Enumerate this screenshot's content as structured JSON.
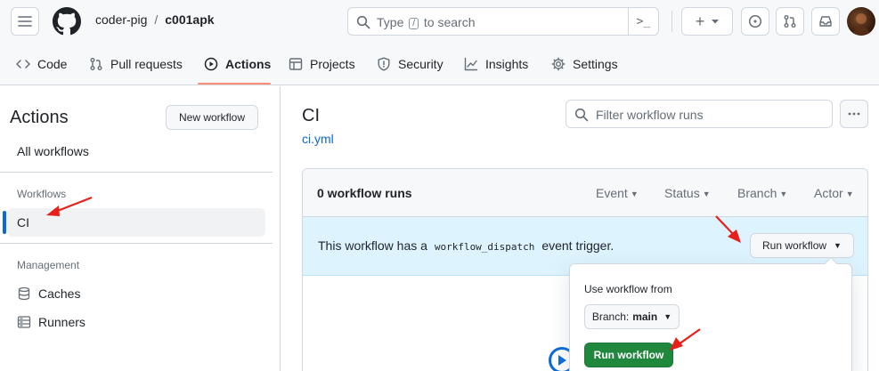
{
  "header": {
    "breadcrumb": {
      "owner": "coder-pig",
      "separator": "/",
      "repo": "c001apk"
    },
    "search": {
      "prefix": "Type",
      "key": "/",
      "suffix": "to search",
      "command_glyph": ">_"
    },
    "create_glyph": "+",
    "icons": [
      "hamburger-icon",
      "github-logo-icon",
      "search-icon",
      "command-palette-icon",
      "plus-icon",
      "issue-icon",
      "pull-request-icon",
      "inbox-icon",
      "avatar"
    ],
    "notification_color": "#0969da"
  },
  "tabs": [
    {
      "label": "Code",
      "icon": "code-icon"
    },
    {
      "label": "Pull requests",
      "icon": "pull-request-icon"
    },
    {
      "label": "Actions",
      "icon": "play-icon",
      "active": true
    },
    {
      "label": "Projects",
      "icon": "table-icon"
    },
    {
      "label": "Security",
      "icon": "shield-icon"
    },
    {
      "label": "Insights",
      "icon": "graph-icon"
    },
    {
      "label": "Settings",
      "icon": "gear-icon"
    }
  ],
  "sidebar": {
    "title": "Actions",
    "new_workflow": "New workflow",
    "all_workflows": "All workflows",
    "workflows_heading": "Workflows",
    "workflows": [
      {
        "label": "CI",
        "selected": true
      }
    ],
    "management_heading": "Management",
    "management_items": [
      {
        "label": "Caches",
        "icon": "database-icon"
      },
      {
        "label": "Runners",
        "icon": "server-icon"
      }
    ]
  },
  "main": {
    "title": "CI",
    "file": "ci.yml",
    "filter_placeholder": "Filter workflow runs",
    "runs_count": "0 workflow runs",
    "filters": [
      "Event",
      "Status",
      "Branch",
      "Actor"
    ],
    "dispatch": {
      "prefix": "This workflow has a",
      "code": "workflow_dispatch",
      "suffix": "event trigger.",
      "button": "Run workflow"
    },
    "dropdown": {
      "label": "Use workflow from",
      "branch_prefix": "Branch:",
      "branch_value": "main",
      "submit": "Run workflow"
    }
  },
  "colors": {
    "accent": "#0969da",
    "primary_button": "#1f883d",
    "banner": "#ddf4ff",
    "tab_underline": "#fd8c73",
    "annotation_arrow": "#e8201b"
  }
}
